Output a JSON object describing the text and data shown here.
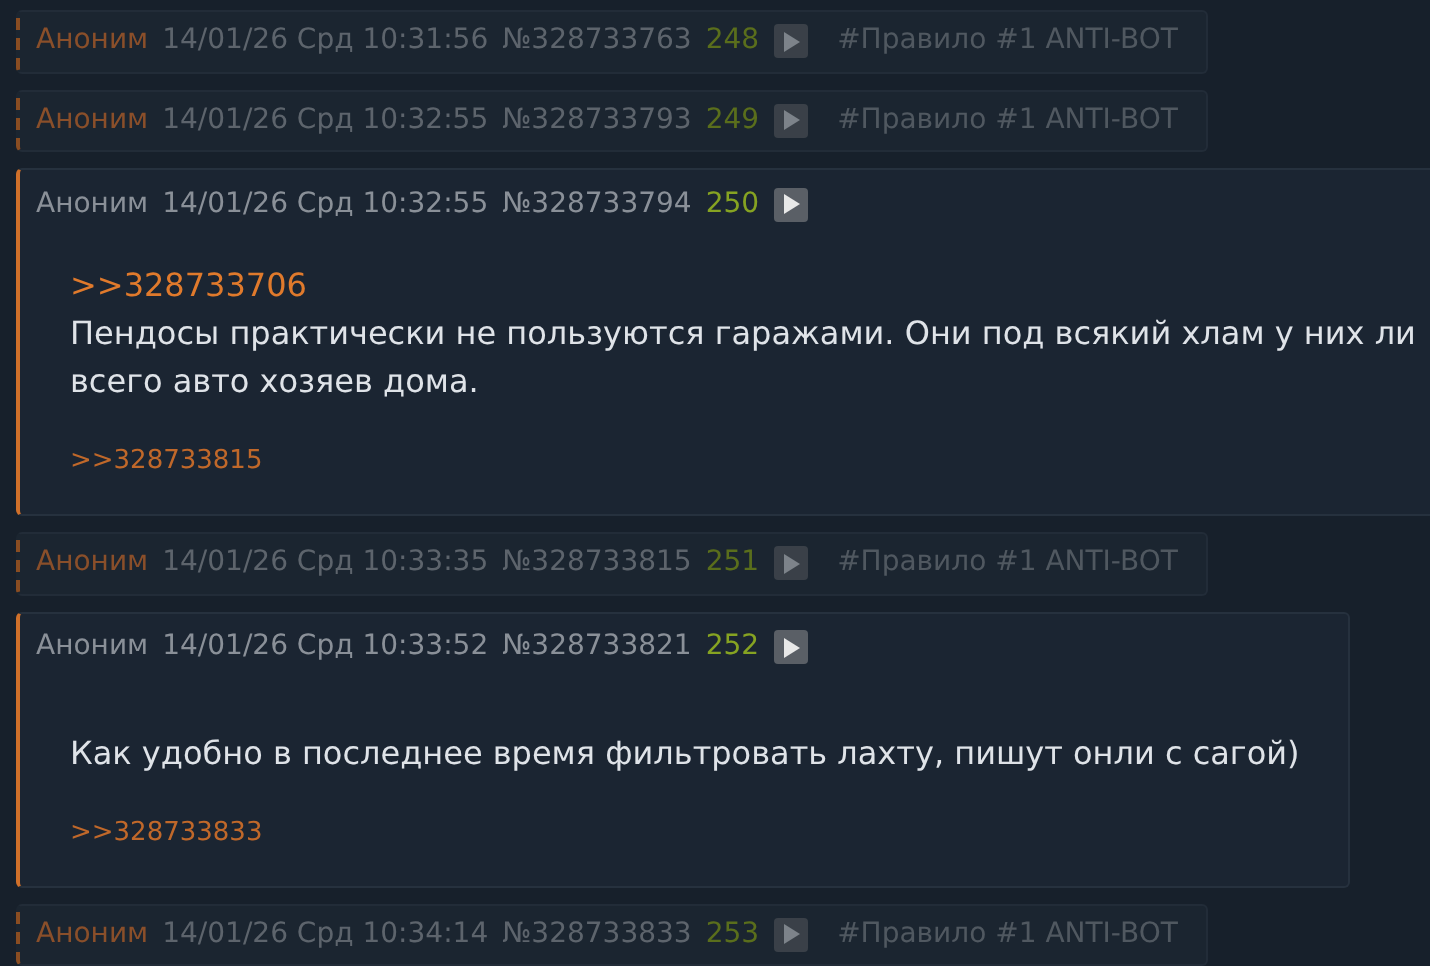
{
  "posts": [
    {
      "kind": "collapsed",
      "name": "Аноним",
      "date": "14/01/26 Срд 10:31:56",
      "number": "№328733763",
      "count": "248",
      "rule": "#Правило #1 ANTI-BOT"
    },
    {
      "kind": "collapsed",
      "name": "Аноним",
      "date": "14/01/26 Срд 10:32:55",
      "number": "№328733793",
      "count": "249",
      "rule": "#Правило #1 ANTI-BOT"
    },
    {
      "kind": "full",
      "name": "Аноним",
      "date": "14/01/26 Срд 10:32:55",
      "number": "№328733794",
      "count": "250",
      "reply_to": ">>328733706",
      "body_lines": [
        "Пендосы практически не пользуются гаражами. Они под всякий хлам у них ли",
        "всего авто хозяев дома."
      ],
      "replies": ">>328733815"
    },
    {
      "kind": "collapsed",
      "name": "Аноним",
      "date": "14/01/26 Срд 10:33:35",
      "number": "№328733815",
      "count": "251",
      "rule": "#Правило #1 ANTI-BOT"
    },
    {
      "kind": "full",
      "name": "Аноним",
      "date": "14/01/26 Срд 10:33:52",
      "number": "№328733821",
      "count": "252",
      "body_lines": [
        "Как удобно в последнее время фильтровать лахту, пишут онли с сагой)"
      ],
      "replies": ">>328733833"
    },
    {
      "kind": "collapsed",
      "name": "Аноним",
      "date": "14/01/26 Срд 10:34:14",
      "number": "№328733833",
      "count": "253",
      "rule": "#Правило #1 ANTI-BOT"
    }
  ]
}
